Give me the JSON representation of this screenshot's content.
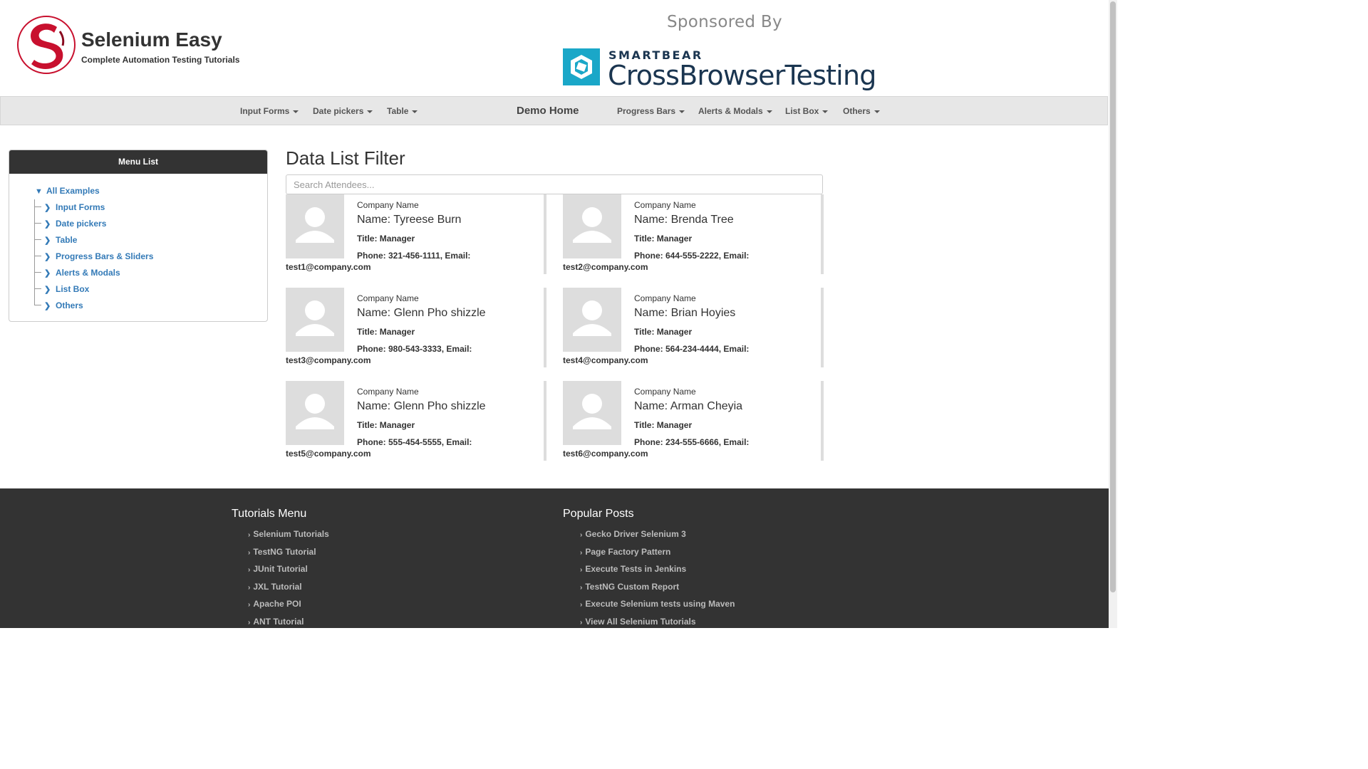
{
  "header": {
    "title": "Selenium Easy",
    "subtitle": "Complete Automation Testing Tutorials",
    "sponsor_text": "Sponsored By",
    "sponsor_small": "SMARTBEAR",
    "sponsor_big": "CrossBrowserTesting"
  },
  "nav": {
    "items": [
      "Input Forms",
      "Date pickers",
      "Table",
      "Demo Home",
      "Progress Bars",
      "Alerts & Modals",
      "List Box",
      "Others"
    ]
  },
  "sidebar": {
    "heading": "Menu List",
    "root": "All Examples",
    "items": [
      "Input Forms",
      "Date pickers",
      "Table",
      "Progress Bars & Sliders",
      "Alerts & Modals",
      "List Box",
      "Others"
    ]
  },
  "main": {
    "heading": "Data List Filter",
    "search_placeholder": "Search Attendees...",
    "cards": [
      {
        "company": "Company Name",
        "name": "Name: Tyreese Burn",
        "title": "Title: Manager",
        "contact_line1": "Phone: 321-456-1111, Email:",
        "contact_line2": "test1@company.com"
      },
      {
        "company": "Company Name",
        "name": "Name: Brenda Tree",
        "title": "Title: Manager",
        "contact_line1": "Phone: 644-555-2222, Email:",
        "contact_line2": "test2@company.com"
      },
      {
        "company": "Company Name",
        "name": "Name: Glenn Pho shizzle",
        "title": "Title: Manager",
        "contact_line1": "Phone: 980-543-3333, Email:",
        "contact_line2": "test3@company.com"
      },
      {
        "company": "Company Name",
        "name": "Name: Brian Hoyies",
        "title": "Title: Manager",
        "contact_line1": "Phone: 564-234-4444, Email:",
        "contact_line2": "test4@company.com"
      },
      {
        "company": "Company Name",
        "name": "Name: Glenn Pho shizzle",
        "title": "Title: Manager",
        "contact_line1": "Phone: 555-454-5555, Email:",
        "contact_line2": "test5@company.com"
      },
      {
        "company": "Company Name",
        "name": "Name: Arman Cheyia",
        "title": "Title: Manager",
        "contact_line1": "Phone: 234-555-6666, Email:",
        "contact_line2": "test6@company.com"
      }
    ]
  },
  "footer": {
    "tutorials_heading": "Tutorials Menu",
    "tutorials": [
      "Selenium Tutorials",
      "TestNG Tutorial",
      "JUnit Tutorial",
      "JXL Tutorial",
      "Apache POI",
      "ANT Tutorial"
    ],
    "popular_heading": "Popular Posts",
    "popular": [
      "Gecko Driver Selenium 3",
      "Page Factory Pattern",
      "Execute Tests in Jenkins",
      "TestNG Custom Report",
      "Execute Selenium tests using Maven",
      "View All Selenium Tutorials"
    ]
  },
  "colors": {
    "link": "#337ab7",
    "navbar": "#e7e7e7",
    "menu_header": "#333333",
    "footer": "#333333",
    "logo_red": "#c8102e",
    "sponsor_teal": "#1aa7c8"
  }
}
